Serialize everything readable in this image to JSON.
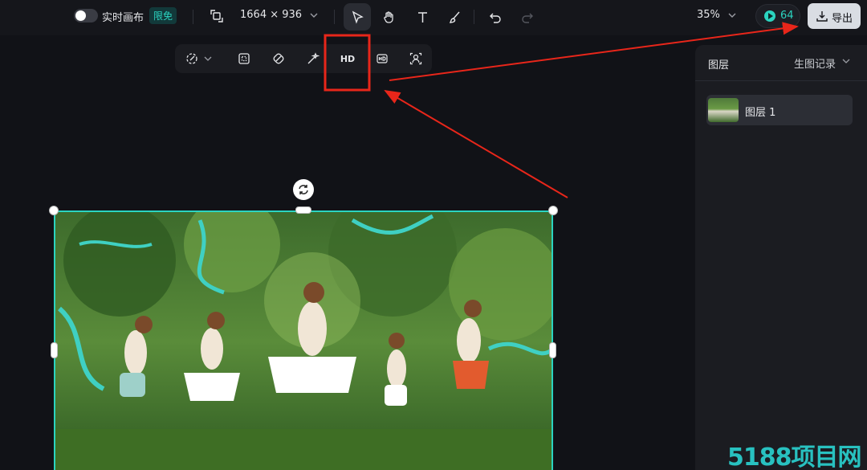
{
  "topbar": {
    "realtime_label": "实时画布",
    "realtime_badge": "限免",
    "dimensions": "1664 × 936",
    "zoom": "35%",
    "credits": "64",
    "export_label": "导出"
  },
  "subtoolbar": {
    "hd_label": "HD"
  },
  "right_panel": {
    "title": "图层",
    "history": "生图记录",
    "layers": [
      {
        "name": "图层 1"
      }
    ]
  },
  "watermark": "5188项目网",
  "colors": {
    "accent": "#2bd4c0",
    "annotation": "#e8261a",
    "background": "#111217"
  }
}
